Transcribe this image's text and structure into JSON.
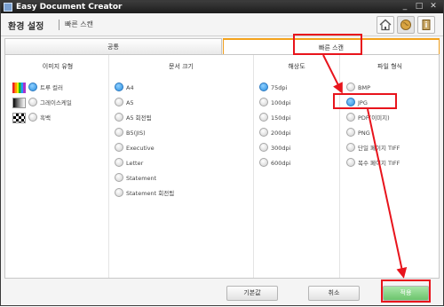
{
  "window": {
    "title": "Easy Document Creator",
    "minimize": "_",
    "maximize": "□",
    "close": "✕"
  },
  "header": {
    "main_title": "환경 설정",
    "sub_title": "빠른 스캔"
  },
  "header_icons": [
    "home-icon",
    "globe-icon",
    "info-book-icon"
  ],
  "tabs": [
    {
      "label": "공통",
      "selected": false
    },
    {
      "label": "빠른 스캔",
      "selected": true
    }
  ],
  "columns": {
    "image_type": {
      "heading": "이미지 유형",
      "options": [
        {
          "label": "트루 컬러",
          "selected": true
        },
        {
          "label": "그레이스케일",
          "selected": false
        },
        {
          "label": "흑백",
          "selected": false
        }
      ]
    },
    "doc_size": {
      "heading": "문서 크기",
      "options": [
        {
          "label": "A4",
          "selected": true
        },
        {
          "label": "A5",
          "selected": false
        },
        {
          "label": "A5 회전됨",
          "selected": false
        },
        {
          "label": "B5(JIS)",
          "selected": false
        },
        {
          "label": "Executive",
          "selected": false
        },
        {
          "label": "Letter",
          "selected": false
        },
        {
          "label": "Statement",
          "selected": false
        },
        {
          "label": "Statement 회전됨",
          "selected": false
        }
      ]
    },
    "resolution": {
      "heading": "해상도",
      "options": [
        {
          "label": "75dpi",
          "selected": true
        },
        {
          "label": "100dpi",
          "selected": false
        },
        {
          "label": "150dpi",
          "selected": false
        },
        {
          "label": "200dpi",
          "selected": false
        },
        {
          "label": "300dpi",
          "selected": false
        },
        {
          "label": "600dpi",
          "selected": false
        }
      ]
    },
    "file_format": {
      "heading": "파일 형식",
      "options": [
        {
          "label": "BMP",
          "selected": false
        },
        {
          "label": "JPG",
          "selected": true
        },
        {
          "label": "PDF(이미지)",
          "selected": false
        },
        {
          "label": "PNG",
          "selected": false
        },
        {
          "label": "단일 페이지 TIFF",
          "selected": false
        },
        {
          "label": "복수 페이지 TIFF",
          "selected": false
        }
      ]
    }
  },
  "footer": {
    "default_label": "기본값",
    "cancel_label": "취소",
    "apply_label": "적용"
  },
  "colors": {
    "accent_tab": "#f3a21c",
    "highlight": "#e8141c",
    "radio_selected": "#2a8fe0",
    "apply_bg": "#7fd07f"
  }
}
